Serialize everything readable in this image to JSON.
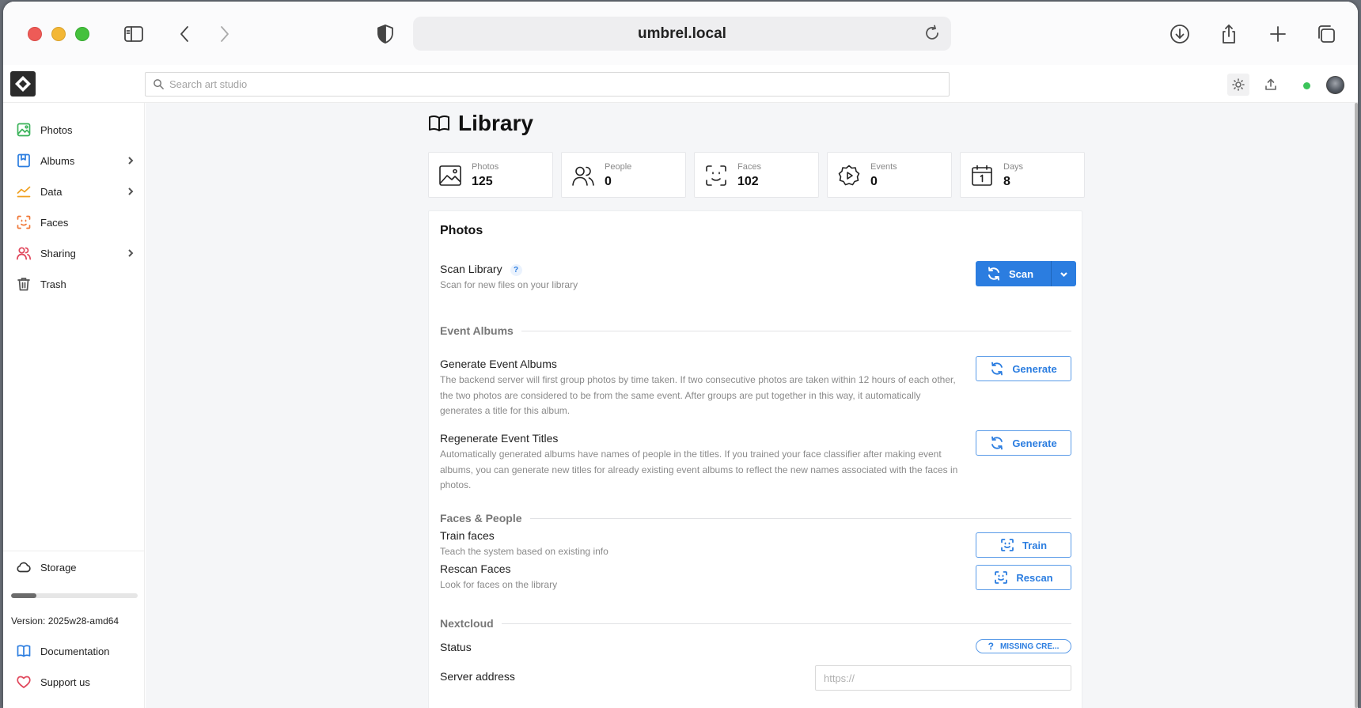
{
  "browser": {
    "url": "umbrel.local"
  },
  "header": {
    "search_placeholder": "Search art studio"
  },
  "sidebar": {
    "items": [
      {
        "label": "Photos",
        "icon": "image-icon",
        "color": "#3bb35a",
        "has_chevron": false
      },
      {
        "label": "Albums",
        "icon": "album-icon",
        "color": "#2b7de0",
        "has_chevron": true
      },
      {
        "label": "Data",
        "icon": "chart-icon",
        "color": "#f0a020",
        "has_chevron": true
      },
      {
        "label": "Faces",
        "icon": "face-scan-icon",
        "color": "#f07838",
        "has_chevron": false
      },
      {
        "label": "Sharing",
        "icon": "people-icon",
        "color": "#e0455a",
        "has_chevron": true
      },
      {
        "label": "Trash",
        "icon": "trash-icon",
        "color": "#555555",
        "has_chevron": false
      }
    ],
    "storage_label": "Storage",
    "storage_fraction": 0.2,
    "version": "Version: 2025w28-amd64",
    "documentation_label": "Documentation",
    "support_label": "Support us"
  },
  "main": {
    "title": "Library",
    "stats": [
      {
        "label": "Photos",
        "value": "125",
        "icon": "image-icon"
      },
      {
        "label": "People",
        "value": "0",
        "icon": "people-icon"
      },
      {
        "label": "Faces",
        "value": "102",
        "icon": "face-scan-icon"
      },
      {
        "label": "Events",
        "value": "0",
        "icon": "event-badge-icon"
      },
      {
        "label": "Days",
        "value": "8",
        "icon": "calendar-icon"
      }
    ],
    "card": {
      "title": "Photos",
      "scan": {
        "title": "Scan Library",
        "help": "?",
        "desc": "Scan for new files on your library",
        "button": "Scan"
      },
      "event_albums": {
        "section": "Event Albums",
        "generate_title": "Generate Event Albums",
        "generate_desc": "The backend server will first group photos by time taken. If two consecutive photos are taken within 12 hours of each other, the two photos are considered to be from the same event. After groups are put together in this way, it automatically generates a title for this album.",
        "generate_button": "Generate",
        "regen_title": "Regenerate Event Titles",
        "regen_desc": "Automatically generated albums have names of people in the titles. If you trained your face classifier after making event albums, you can generate new titles for already existing event albums to reflect the new names associated with the faces in photos.",
        "regen_button": "Generate"
      },
      "faces": {
        "section": "Faces & People",
        "train_title": "Train faces",
        "train_desc": "Teach the system based on existing info",
        "train_button": "Train",
        "rescan_title": "Rescan Faces",
        "rescan_desc": "Look for faces on the library",
        "rescan_button": "Rescan"
      },
      "nextcloud": {
        "section": "Nextcloud",
        "status_title": "Status",
        "status_value": "MISSING CRE...",
        "status_icon": "?",
        "address_title": "Server address",
        "address_placeholder": "https://"
      }
    }
  },
  "colors": {
    "accent": "#2b7de0",
    "online": "#3bc45a"
  }
}
